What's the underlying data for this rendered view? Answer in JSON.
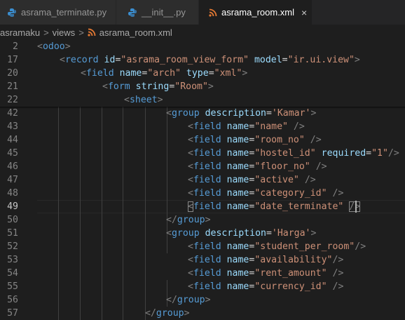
{
  "tabs": [
    {
      "label": "asrama_terminate.py",
      "icon": "python-icon",
      "active": false
    },
    {
      "label": "__init__.py",
      "icon": "python-icon",
      "active": false
    },
    {
      "label": "asrama_room.xml",
      "icon": "rss-icon",
      "active": true
    }
  ],
  "tab_close": "×",
  "breadcrumb": {
    "items": [
      "asramaku",
      "views",
      "asrama_room.xml"
    ],
    "separator": ">"
  },
  "lines": [
    {
      "num": "2",
      "text": "<odoo>"
    },
    {
      "num": "17",
      "text": "<record id=\"asrama_room_view_form\" model=\"ir.ui.view\">"
    },
    {
      "num": "20",
      "text": "<field name=\"arch\" type=\"xml\">"
    },
    {
      "num": "21",
      "text": "<form string=\"Room\">"
    },
    {
      "num": "22",
      "text": "<sheet>"
    },
    {
      "num": "42",
      "text": "<group description='Kamar'>"
    },
    {
      "num": "43",
      "text": "<field name=\"name\" />"
    },
    {
      "num": "44",
      "text": "<field name=\"room_no\" />"
    },
    {
      "num": "45",
      "text": "<field name=\"hostel_id\" required=\"1\"/>"
    },
    {
      "num": "46",
      "text": "<field name=\"floor_no\" />"
    },
    {
      "num": "47",
      "text": "<field name=\"active\" />"
    },
    {
      "num": "48",
      "text": "<field name=\"category_id\" />"
    },
    {
      "num": "49",
      "text": "<field name=\"date_terminate\" />"
    },
    {
      "num": "50",
      "text": "</group>"
    },
    {
      "num": "51",
      "text": "<group description='Harga'>"
    },
    {
      "num": "52",
      "text": "<field name=\"student_per_room\"/>"
    },
    {
      "num": "53",
      "text": "<field name=\"availability\"/>"
    },
    {
      "num": "54",
      "text": "<field name=\"rent_amount\" />"
    },
    {
      "num": "55",
      "text": "<field name=\"currency_id\" />"
    },
    {
      "num": "56",
      "text": "</group>"
    },
    {
      "num": "57",
      "text": "</group>"
    }
  ],
  "current_line": "49",
  "colors": {
    "background": "#1e1e1e",
    "tag_bracket": "#808080",
    "tag_name": "#569cd6",
    "attribute": "#9cdcfe",
    "string": "#ce9178",
    "python_icon": "#3b8ed0",
    "rss_icon": "#e37933"
  }
}
